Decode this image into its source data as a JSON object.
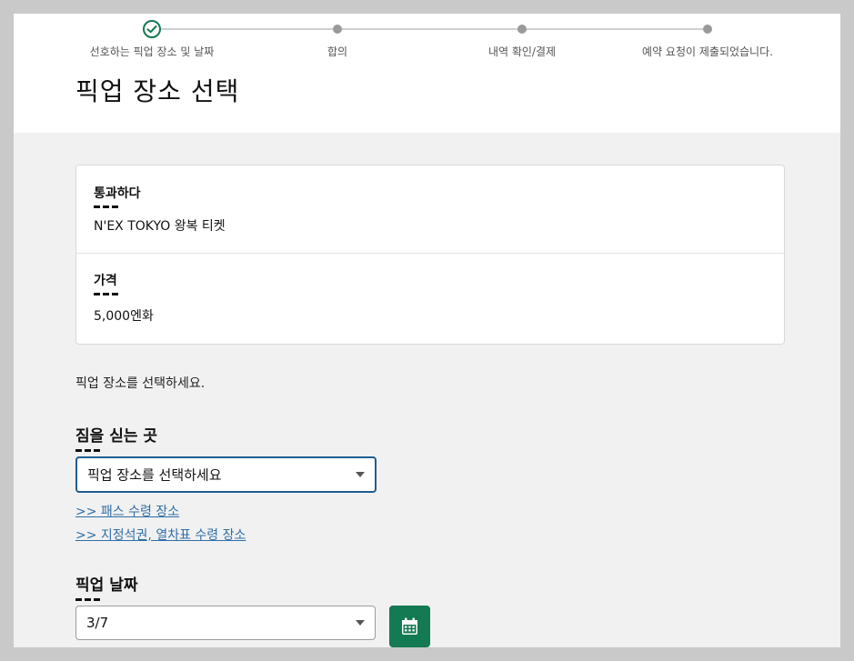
{
  "stepper": {
    "steps": [
      {
        "label": "선호하는 픽업 장소 및 날짜",
        "status": "completed"
      },
      {
        "label": "합의",
        "status": "upcoming"
      },
      {
        "label": "내역 확인/결제",
        "status": "upcoming"
      },
      {
        "label": "예약 요청이 제출되었습니다.",
        "status": "upcoming"
      }
    ]
  },
  "page": {
    "title": "픽업 장소 선택",
    "instructions": "픽업 장소를 선택하세요."
  },
  "summary": {
    "pass_label": "통과하다",
    "pass_value": "N'EX TOKYO 왕복 티켓",
    "price_label": "가격",
    "price_value": "5,000엔화"
  },
  "pickup_location": {
    "label": "짐을 싣는 곳",
    "selected": "픽업 장소를 선택하세요",
    "links": [
      ">> 패스 수령 장소",
      ">> 지정석권, 열차표 수령 장소"
    ]
  },
  "pickup_date": {
    "label": "픽업 날짜",
    "selected": "3/7"
  },
  "icons": {
    "completed_step": "check-circle-icon",
    "dropdown": "chevron-down-icon",
    "calendar": "calendar-icon"
  },
  "colors": {
    "accent_green": "#137a53",
    "focus_border": "#1f5c91",
    "link": "#2f6ea8"
  }
}
